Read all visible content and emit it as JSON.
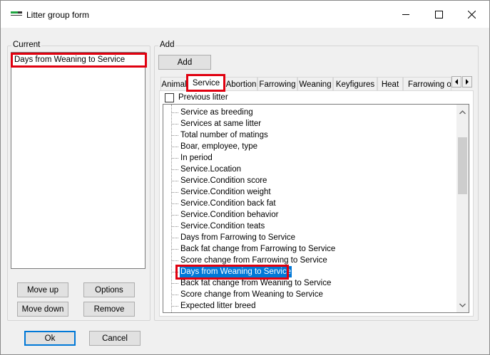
{
  "window": {
    "title": "Litter group form"
  },
  "current": {
    "label": "Current",
    "items": [
      "Days from Weaning  to Service"
    ]
  },
  "add": {
    "label": "Add",
    "add_button": "Add",
    "tabs": [
      "Animal",
      "Service",
      "Abortion",
      "Farrowing",
      "Weaning",
      "Keyfigures",
      "Heat",
      "Farrowing ob"
    ],
    "active_tab": "Service",
    "previous_litter_label": "Previous litter",
    "tree_items": [
      "Service as breeding",
      "Services at same litter",
      "Total number of matings",
      "Boar, employee, type",
      "In period",
      "Service.Location",
      "Service.Condition score",
      "Service.Condition weight",
      "Service.Condition back fat",
      "Service.Condition behavior",
      "Service.Condition teats",
      "Days from Farrowing  to Service",
      "Back fat change from Farrowing to Service",
      "Score change from Farrowing to Service",
      "Days from Weaning  to Service",
      "Back fat change from Weaning to Service",
      "Score change from Weaning to Service",
      "Expected litter breed"
    ],
    "selected_item": "Days from Weaning  to Service"
  },
  "buttons": {
    "move_up": "Move up",
    "options": "Options",
    "move_down": "Move down",
    "remove": "Remove",
    "ok": "Ok",
    "cancel": "Cancel"
  },
  "colors": {
    "accent": "#0078d7",
    "annotation_red": "#e0000f",
    "selection": "#0078d7"
  },
  "icons": {
    "app": "app-icon",
    "minimize": "minimize-icon",
    "maximize": "maximize-icon",
    "close": "close-icon",
    "tab_left": "chevron-left-icon",
    "tab_right": "chevron-right-icon",
    "scroll_up": "chevron-up-icon",
    "scroll_down": "chevron-down-icon"
  }
}
